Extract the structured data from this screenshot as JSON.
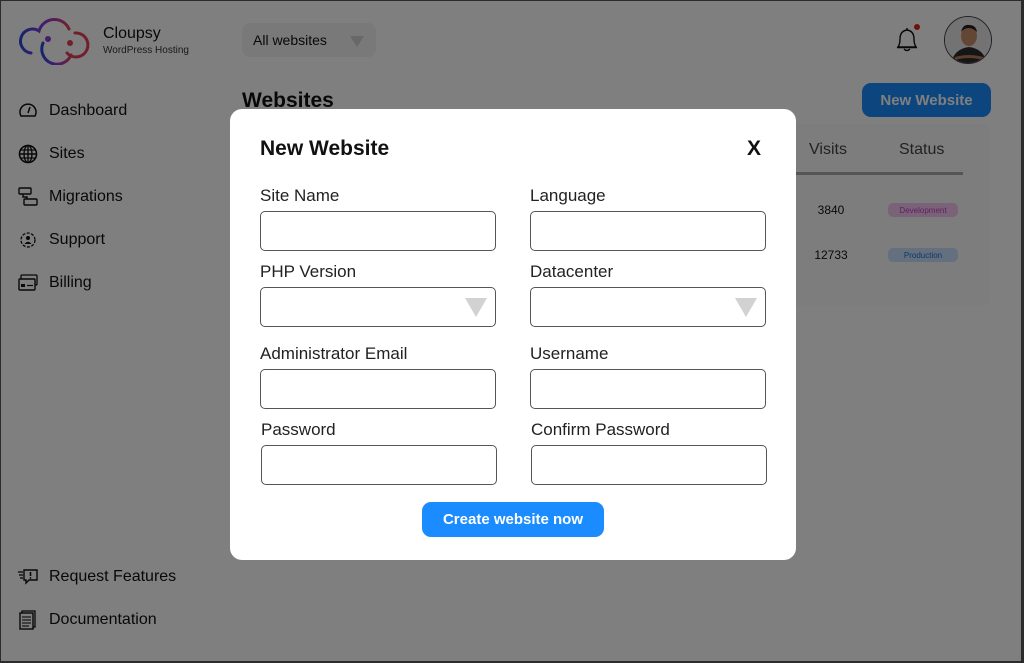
{
  "brand": {
    "name": "Cloupsy",
    "subtitle": "WordPress Hosting"
  },
  "sidebar": {
    "items": [
      {
        "label": "Dashboard",
        "icon": "gauge-icon"
      },
      {
        "label": "Sites",
        "icon": "globe-icon"
      },
      {
        "label": "Migrations",
        "icon": "server-transfer-icon"
      },
      {
        "label": "Support",
        "icon": "gear-person-icon"
      },
      {
        "label": "Billing",
        "icon": "credit-card-icon"
      }
    ],
    "bottom_items": [
      {
        "label": "Request Features",
        "icon": "feedback-icon"
      },
      {
        "label": "Documentation",
        "icon": "document-icon"
      }
    ]
  },
  "header": {
    "filter_value": "All websites",
    "notification_dot_color": "#e0201b"
  },
  "main": {
    "title": "Websites",
    "new_button": "New Website",
    "table": {
      "columns": [
        "Visits",
        "Status"
      ],
      "rows": [
        {
          "visits": "3840",
          "status": "Development",
          "status_color": "#c040c0",
          "status_bg": "#f5c6f0"
        },
        {
          "visits": "12733",
          "status": "Production",
          "status_color": "#1a6ed8",
          "status_bg": "#c9e0fb"
        }
      ]
    }
  },
  "modal": {
    "title": "New Website",
    "close_label": "X",
    "fields": {
      "site_name": {
        "label": "Site Name",
        "value": ""
      },
      "language": {
        "label": "Language",
        "value": ""
      },
      "php_version": {
        "label": "PHP Version",
        "value": ""
      },
      "datacenter": {
        "label": "Datacenter",
        "value": ""
      },
      "admin_email": {
        "label": "Administrator Email",
        "value": ""
      },
      "username": {
        "label": "Username",
        "value": ""
      },
      "password": {
        "label": "Password",
        "value": ""
      },
      "confirm_password": {
        "label": "Confirm Password",
        "value": ""
      }
    },
    "submit_label": "Create website now"
  },
  "colors": {
    "accent": "#1a8cff",
    "overlay": "rgba(0,0,0,0.5)"
  }
}
